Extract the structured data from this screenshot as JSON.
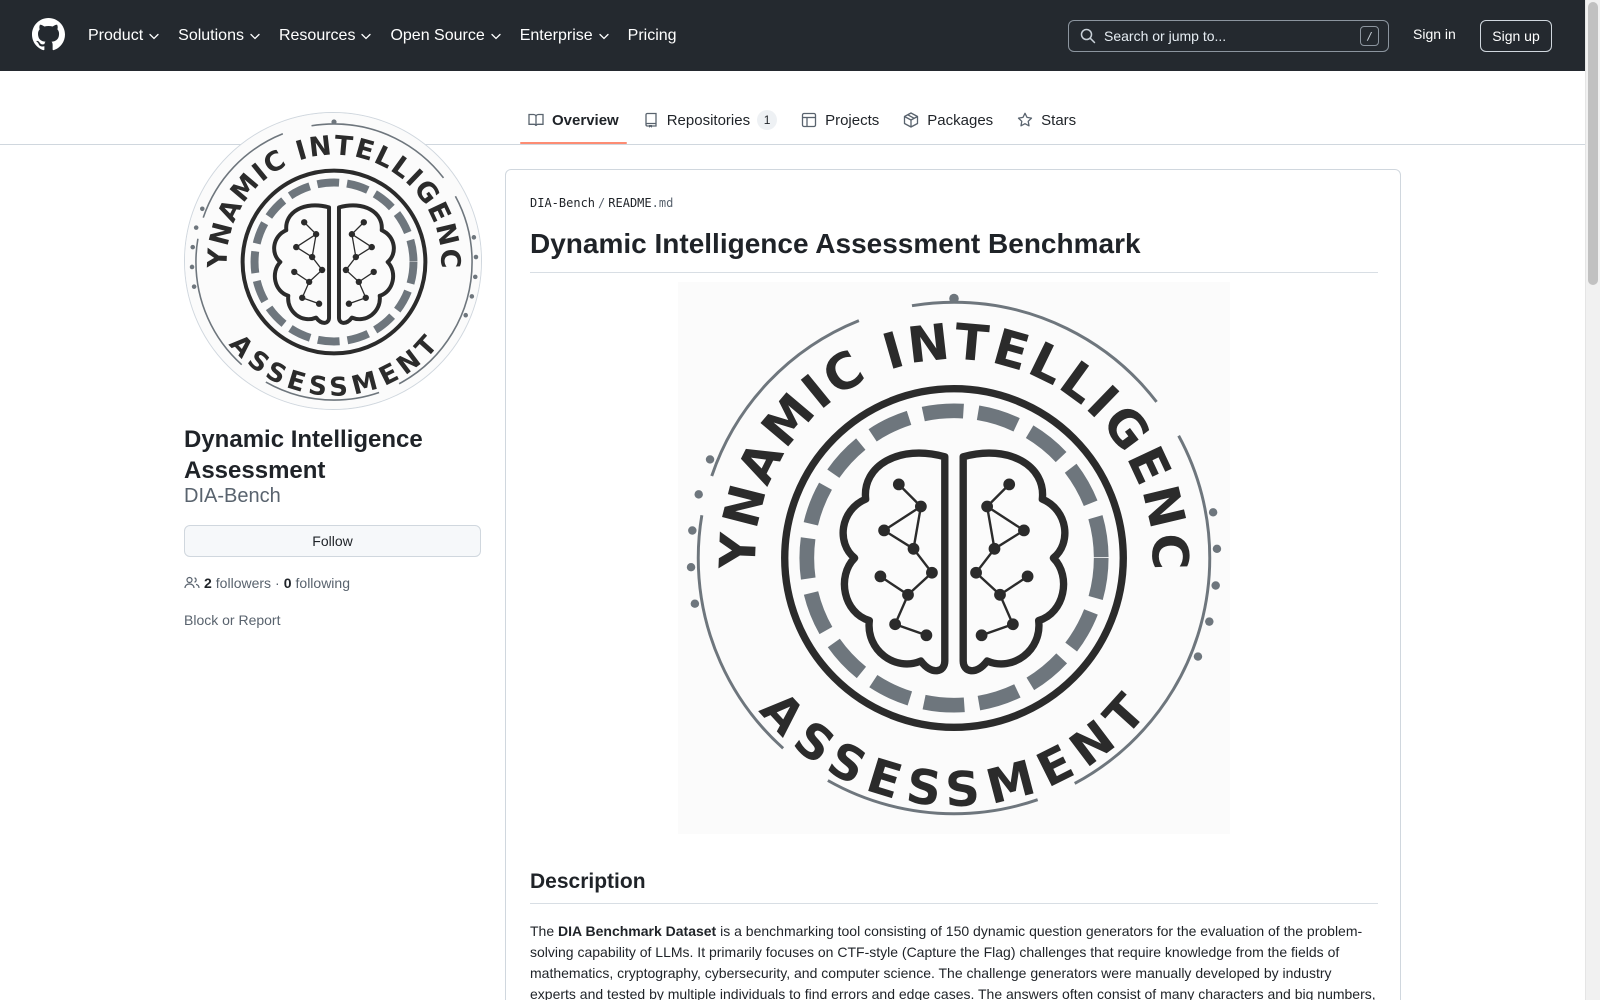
{
  "header": {
    "nav": [
      {
        "label": "Product",
        "has_menu": true
      },
      {
        "label": "Solutions",
        "has_menu": true
      },
      {
        "label": "Resources",
        "has_menu": true
      },
      {
        "label": "Open Source",
        "has_menu": true
      },
      {
        "label": "Enterprise",
        "has_menu": true
      },
      {
        "label": "Pricing",
        "has_menu": false
      }
    ],
    "search_placeholder": "Search or jump to...",
    "search_shortcut": "/",
    "sign_in": "Sign in",
    "sign_up": "Sign up"
  },
  "tabs": [
    {
      "label": "Overview",
      "icon": "book-icon",
      "active": true
    },
    {
      "label": "Repositories",
      "icon": "repo-icon",
      "count": "1"
    },
    {
      "label": "Projects",
      "icon": "table-icon"
    },
    {
      "label": "Packages",
      "icon": "package-icon"
    },
    {
      "label": "Stars",
      "icon": "star-icon"
    }
  ],
  "profile": {
    "name": "Dynamic Intelligence Assessment",
    "login": "DIA-Bench",
    "follow_label": "Follow",
    "followers_count": "2",
    "followers_label": "followers",
    "separator": "·",
    "following_count": "0",
    "following_label": "following",
    "block_label": "Block or Report",
    "logo_text_top": "DYNAMIC INTELLIGENCE",
    "logo_text_bottom": "ASSESSMENT"
  },
  "readme": {
    "repo": "DIA-Bench",
    "sep": "/",
    "file_base": "README",
    "file_ext": ".md",
    "title": "Dynamic Intelligence Assessment Benchmark",
    "section_title": "Description",
    "intro_prefix": "The ",
    "intro_bold": "DIA Benchmark Dataset",
    "intro_rest": " is a benchmarking tool consisting of 150 dynamic question generators for the evaluation of the problem-solving capability of LLMs. It primarily focuses on CTF-style (Capture the Flag) challenges that require knowledge from the fields of mathematics, cryptography, cybersecurity, and computer science. The challenge generators were manually developed by industry experts and tested by multiple individuals to find errors and edge cases. The answers often consist of many characters and big numbers,"
  },
  "colors": {
    "header_bg": "#24292f",
    "active_tab_underline": "#fd8c73",
    "logo_dark": "#2b2b2b",
    "logo_gray": "#6e767d"
  }
}
